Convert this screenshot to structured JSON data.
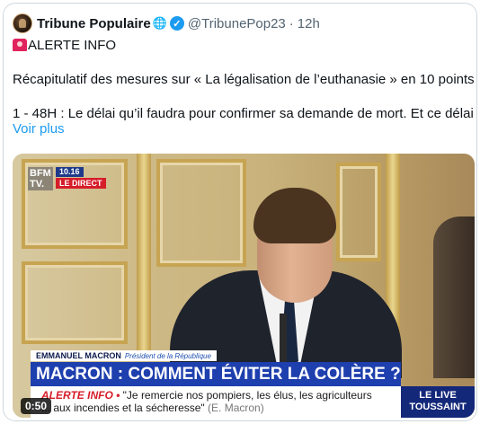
{
  "tweet": {
    "author_name": "Tribune Populaire",
    "globe_glyph": "🌐",
    "verified_glyph": "✓",
    "handle": "@TribunePop23",
    "separator": "·",
    "time": "12h",
    "alert_label": "ALERTE INFO",
    "line2": "Récapitulatif des mesures sur « La légalisation de l’euthanasie » en 10 points :",
    "line3": "1 - 48H : Le délai qu’il faudra pour confirmer sa demande de mort. Et ce délai …",
    "more_label": "Voir plus",
    "icons": {
      "avatar": "avatar",
      "globe": "globe-icon",
      "verified": "verified-badge-icon",
      "alert": "siren-icon"
    },
    "colors": {
      "link": "#1d9bf0",
      "muted": "#536471",
      "text": "#0f1419"
    }
  },
  "video": {
    "channel_logo": "BFM TV.",
    "channel_time": "10.16",
    "channel_direct": "LE DIRECT",
    "speaker_name": "EMMANUEL MACRON",
    "speaker_title": "Président de la République",
    "headline": "MACRON : COMMENT ÉVITER LA COLÈRE ?",
    "ticker_label": "ALERTE INFO",
    "ticker_bullet": "•",
    "ticker_line1": "\"Je remercie nos pompiers, les élus, les agriculteurs",
    "ticker_line2": "... aux incendies et la sécheresse\"",
    "ticker_source": "(E. Macron)",
    "side_line1": "LE LIVE",
    "side_line2": "TOUSSAINT",
    "duration": "0:50",
    "colors": {
      "headline_bg": "#1e3fae",
      "direct_bg": "#d61d2a",
      "side_bg": "#14287a"
    }
  }
}
